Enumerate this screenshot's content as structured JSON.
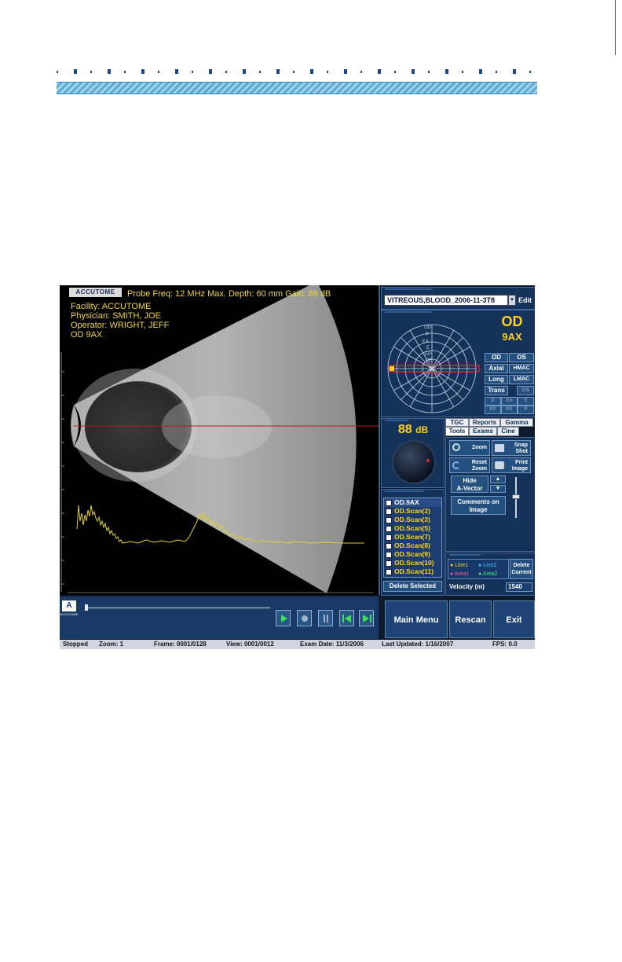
{
  "overlay": {
    "logo_text": "ACCUTOME",
    "probe_info": "Probe Freq: 12 MHz   Max. Depth: 60 mm   Gain: 88 dB",
    "facility": "Facility: ACCUTOME",
    "physician": "Physician: SMITH, JOE",
    "operator": "Operator: WRIGHT, JEFF",
    "exam_label": "OD  9AX"
  },
  "exam": {
    "selected": "VITREOUS,BLOOD_2006-11-3T8",
    "edit_label": "Edit"
  },
  "probe_position": {
    "eye": "OD",
    "view": "9AX",
    "clock_labels": [
      "OD",
      "P",
      "EA",
      "E",
      "EP",
      "PE"
    ],
    "buttons": {
      "od": "OD",
      "os": "OS",
      "axial": "Axial",
      "hmac": "HMAC",
      "long": "Long",
      "lmac": "LMAC",
      "trans": "Trans",
      "gs": "GS",
      "grid": [
        "D",
        "EA",
        "E",
        "EP",
        "PE",
        "P"
      ]
    }
  },
  "tabs": {
    "row1": [
      "TGC",
      "Reports",
      "Gamma"
    ],
    "row2": [
      "Tools",
      "Exams",
      "Cine"
    ]
  },
  "gain": {
    "value": "88",
    "unit": "dB"
  },
  "tools": {
    "zoom": "Zoom",
    "snap_shot": [
      "Snap",
      "Shot"
    ],
    "reset_zoom": [
      "Reset",
      "Zoom"
    ],
    "print_image": [
      "Print",
      "Image"
    ],
    "hide_a_vector": [
      "Hide",
      "A-Vector"
    ],
    "comments": [
      "Comments on",
      "Image"
    ]
  },
  "scans": {
    "items": [
      "OD.9AX",
      "OD.Scan(2)",
      "OD.Scan(3)",
      "OD.Scan(5)",
      "OD.Scan(7)",
      "OD.Scan(8)",
      "OD.Scan(9)",
      "OD.Scan(10)",
      "OD.Scan(11)"
    ],
    "selected_index": 0,
    "delete_label": "Delete Selected"
  },
  "measure": {
    "line1": "Line1",
    "line2": "Line2",
    "area1": "Area1",
    "area2": "Area2",
    "delete_current": [
      "Delete",
      "Current"
    ],
    "velocity_label": "Velocity (m)",
    "velocity_value": "1540"
  },
  "nav": {
    "main_menu": "Main Menu",
    "rescan": "Rescan",
    "exit": "Exit"
  },
  "status": {
    "state": "Stopped",
    "zoom": "Zoom: 1",
    "frame": "Frame: 0001/0128",
    "view": "View: 0001/0012",
    "exam_date": "Exam Date: 11/3/2006",
    "last_updated": "Last Updated: 1/16/2007",
    "fps": "FPS: 0.0"
  },
  "colors": {
    "overlay_text": "#f1d437",
    "panel_bg": "#14325a",
    "accent_yellow": "#ffd21a",
    "probe_line": "#ff2a2a"
  }
}
